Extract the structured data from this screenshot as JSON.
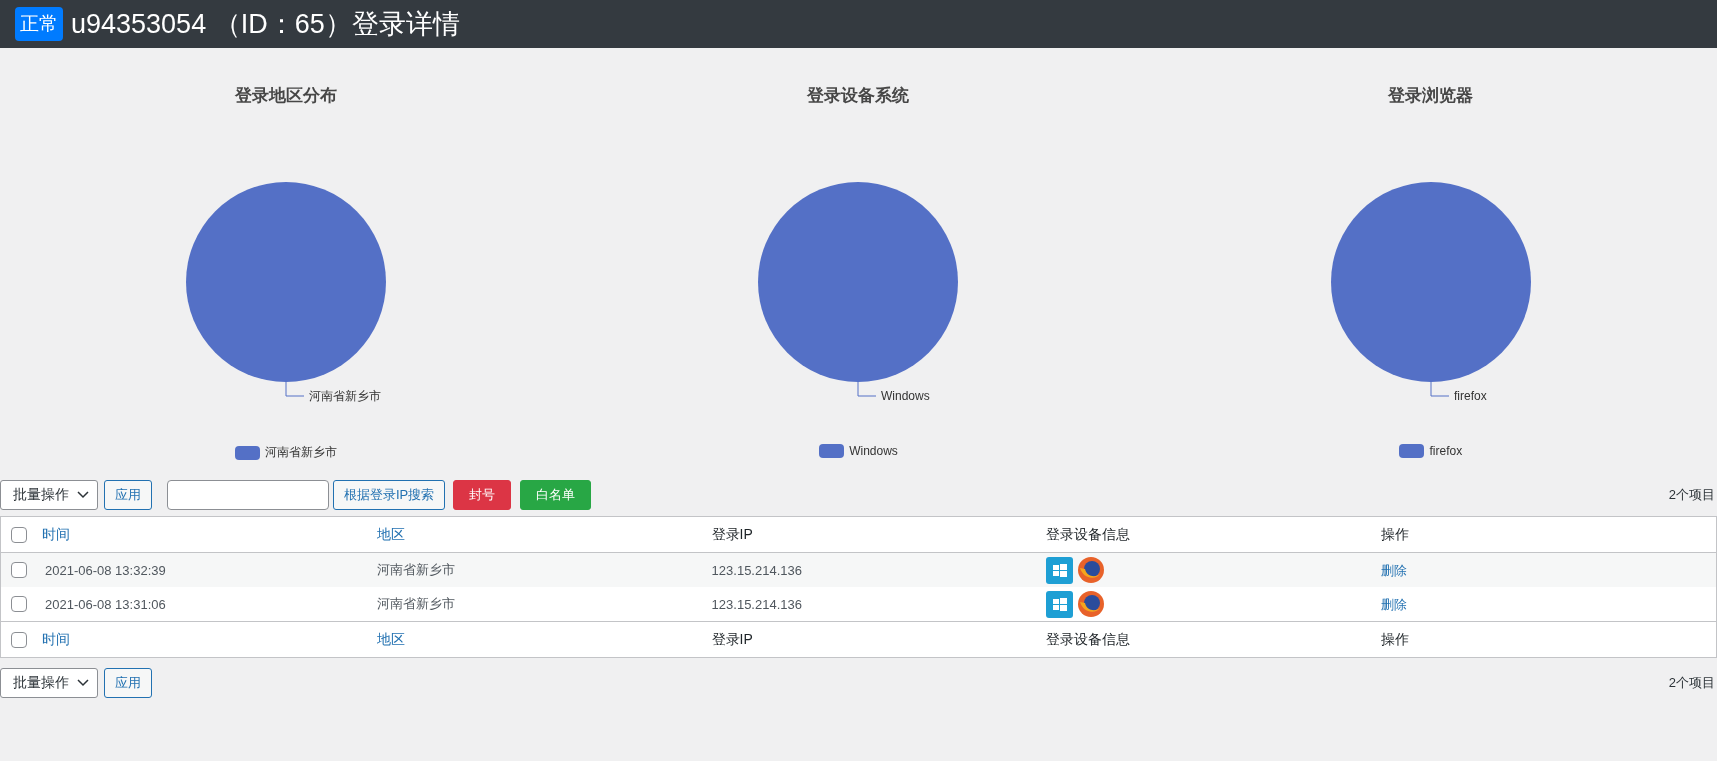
{
  "header": {
    "status_badge": "正常",
    "title": "u94353054 （ID：65）登录详情"
  },
  "charts": [
    {
      "title": "登录地区分布",
      "slices": [
        {
          "label": "河南省新乡市",
          "color": "#5470c6"
        }
      ],
      "legend": [
        {
          "label": "河南省新乡市",
          "color": "#5470c6"
        }
      ]
    },
    {
      "title": "登录设备系统",
      "slices": [
        {
          "label": "Windows",
          "color": "#5470c6"
        }
      ],
      "legend": [
        {
          "label": "Windows",
          "color": "#5470c6"
        }
      ]
    },
    {
      "title": "登录浏览器",
      "slices": [
        {
          "label": "firefox",
          "color": "#5470c6"
        }
      ],
      "legend": [
        {
          "label": "firefox",
          "color": "#5470c6"
        }
      ]
    }
  ],
  "top_toolbar": {
    "bulk_select": "批量操作",
    "apply": "应用",
    "search_button": "根据登录IP搜索",
    "ban_button": "封号",
    "whitelist_button": "白名单",
    "count": "2个项目"
  },
  "table": {
    "columns": [
      {
        "label": "时间",
        "sortable": true
      },
      {
        "label": "地区",
        "sortable": true
      },
      {
        "label": "登录IP",
        "sortable": false
      },
      {
        "label": "登录设备信息",
        "sortable": false
      },
      {
        "label": "操作",
        "sortable": false
      }
    ],
    "header_checked": false,
    "rows": [
      {
        "checked": false,
        "time": "2021-06-08 13:32:39",
        "region": "河南省新乡市",
        "ip": "123.15.214.136",
        "devices": [
          {
            "kind": "windows"
          },
          {
            "kind": "firefox"
          }
        ],
        "action": "删除"
      },
      {
        "checked": false,
        "time": "2021-06-08 13:31:06",
        "region": "河南省新乡市",
        "ip": "123.15.214.136",
        "devices": [
          {
            "kind": "windows"
          },
          {
            "kind": "firefox"
          }
        ],
        "action": "删除"
      }
    ],
    "footer_checked": false,
    "footer_columns": [
      {
        "label": "时间",
        "sortable": true
      },
      {
        "label": "地区",
        "sortable": true
      },
      {
        "label": "登录IP",
        "sortable": false
      },
      {
        "label": "登录设备信息",
        "sortable": false
      },
      {
        "label": "操作",
        "sortable": false
      }
    ]
  },
  "bottom_toolbar": {
    "bulk_select": "批量操作",
    "apply": "应用",
    "count": "2个项目"
  }
}
